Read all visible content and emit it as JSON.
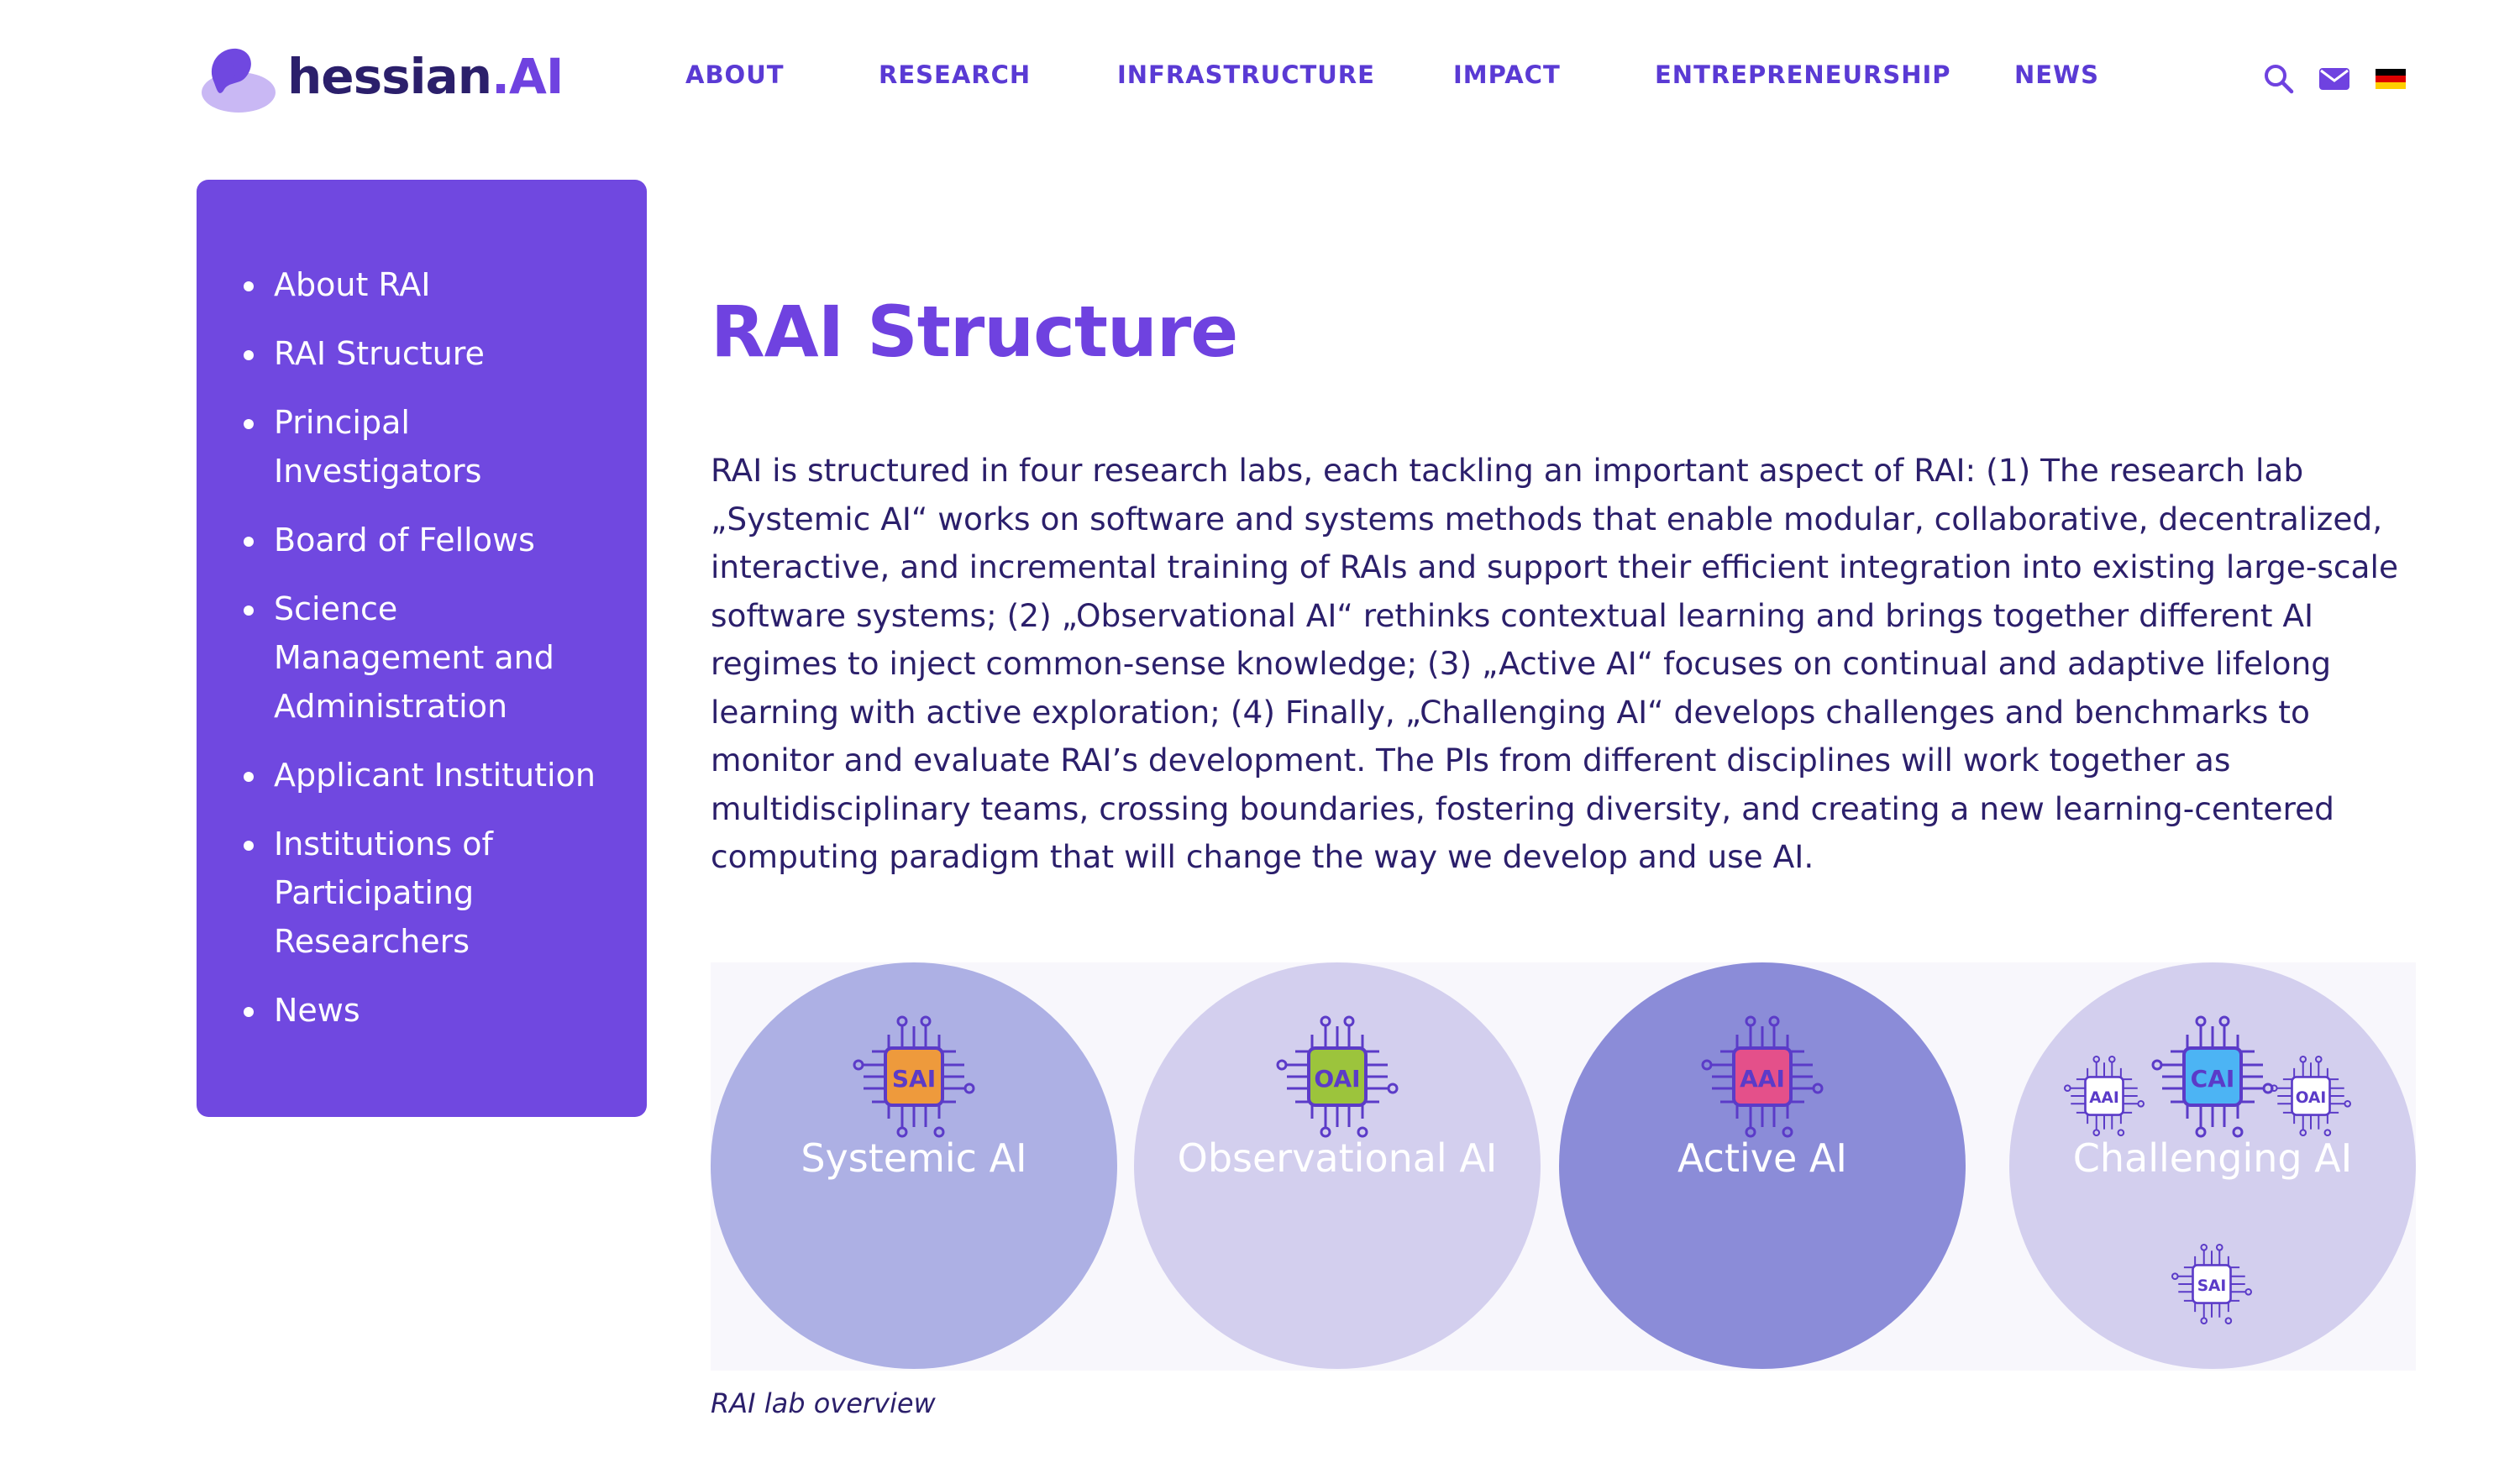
{
  "brand": {
    "name": "hessian",
    "suffix": ".AI"
  },
  "nav": {
    "items": [
      "ABOUT",
      "RESEARCH",
      "INFRASTRUCTURE",
      "IMPACT",
      "ENTREPRENEURSHIP",
      "NEWS"
    ]
  },
  "utility": {
    "search_icon": "search-icon",
    "mail_icon": "mail-icon",
    "language_flag": "german-flag-icon"
  },
  "sidebar": {
    "items": [
      "About RAI",
      "RAI Structure",
      "Principal Investigators",
      "Board of Fellows",
      "Science Management and Administration",
      "Applicant Institution",
      "Institutions of Participating Researchers",
      "News"
    ]
  },
  "main": {
    "title": "RAI Structure",
    "intro": "RAI is structured in four research labs, each tackling an important aspect of RAI: (1) The research lab „Systemic AI“ works on software and systems methods that enable modular, collaborative, decentralized, interactive, and incremental training of RAIs and support their efficient integration into existing large-scale software systems; (2) „Observational AI“ rethinks contextual learning and brings together different AI regimes to inject common-sense knowledge; (3) „Active AI“ focuses on continual and adaptive lifelong learning with active exploration; (4) Finally, „Challenging AI“ develops challenges and benchmarks to monitor and evaluate RAI’s development. The PIs from different disciplines will work together as multidisciplinary teams, crossing boundaries, fostering diversity, and creating a new learning-centered computing paradigm that will change the way we develop and use AI."
  },
  "figure": {
    "labs": [
      {
        "label": "Systemic AI",
        "chip": "SAI",
        "circle_color": "#adb0e4",
        "chip_color": "#ee9a3c"
      },
      {
        "label": "Observational AI",
        "chip": "OAI",
        "circle_color": "#d3cfee",
        "chip_color": "#9cc43c"
      },
      {
        "label": "Active AI",
        "chip": "AAI",
        "circle_color": "#8b8cd8",
        "chip_color": "#e4508a"
      },
      {
        "label": "Challenging AI",
        "chip": "CAI",
        "circle_color": "#d3cfee",
        "chip_color": "#4cb4f4",
        "small_chips": [
          "AAI",
          "OAI",
          "SAI"
        ]
      }
    ],
    "caption": "RAI lab overview"
  },
  "colors": {
    "accent": "#6f42e0",
    "sidebar_bg": "#7048e0",
    "text": "#2b1f6b",
    "nav": "#5a3ad4"
  }
}
